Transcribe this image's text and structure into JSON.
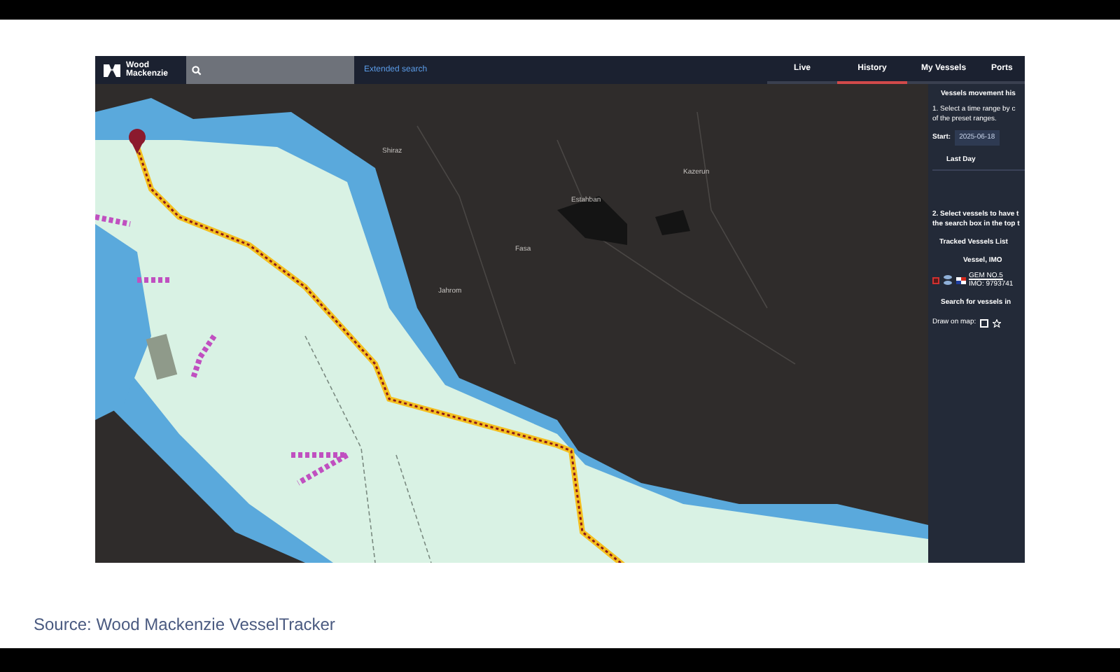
{
  "header": {
    "logo": "Wood Mackenzie",
    "extended_search": "Extended search",
    "tabs": [
      {
        "label": "Live",
        "selected": false
      },
      {
        "label": "History",
        "selected": true
      },
      {
        "label": "My Vessels",
        "selected": false
      },
      {
        "label": "Ports",
        "selected": false
      }
    ]
  },
  "map_labels": [
    "Shiraz",
    "Jahrom",
    "Estahban",
    "Fasa",
    "Kazerun"
  ],
  "sidebar": {
    "title": "Vessels movement his",
    "step1": [
      "1. Select a time range by c",
      "of the preset ranges."
    ],
    "start_label": "Start:",
    "start_value": "2025-06-18",
    "preset": "Last Day",
    "step2": [
      "2. Select vessels to have t",
      "the search box in the top t"
    ],
    "tracked_title": "Tracked Vessels List",
    "column": "Vessel, IMO",
    "vessels": [
      {
        "name": "GEM NO.5",
        "imo": "IMO: 9793741",
        "checked": false
      }
    ],
    "search_note": "Search for vessels in",
    "draw_label": "Draw on map:"
  },
  "caption": "Source: Wood Mackenzie VesselTracker"
}
